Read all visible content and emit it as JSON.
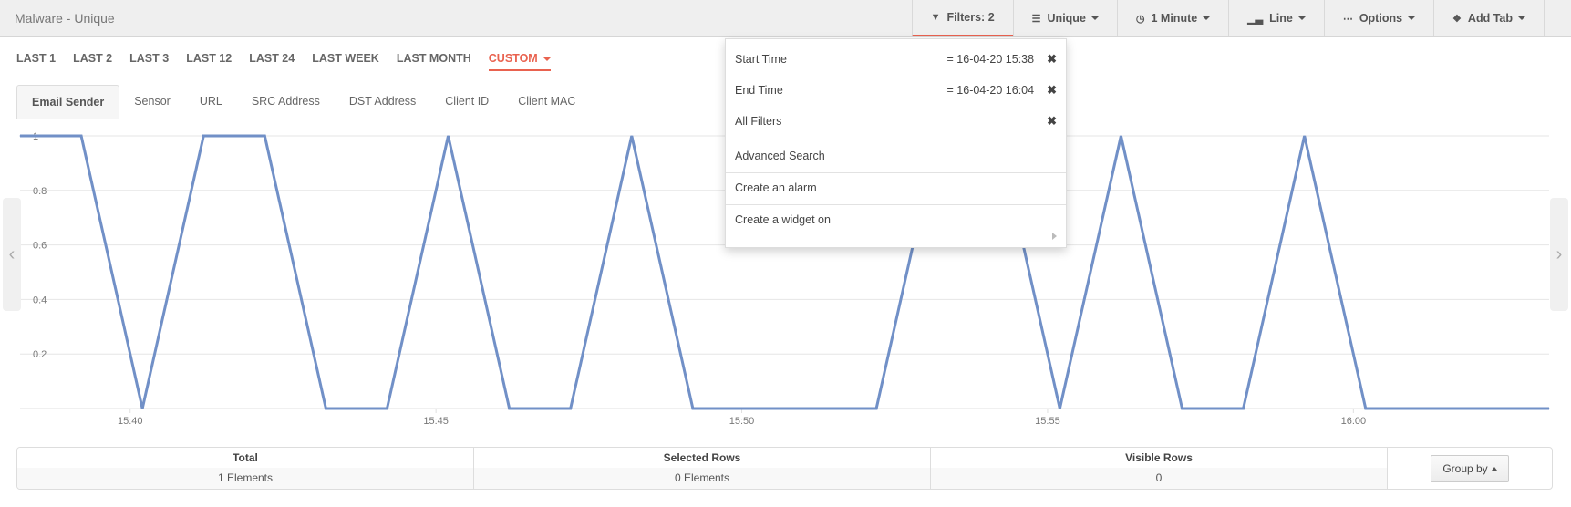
{
  "header": {
    "title": "Malware - Unique",
    "buttons": [
      {
        "icon": "filter-icon",
        "label": "Filters: 2",
        "caret": false
      },
      {
        "icon": "list-icon",
        "label": "Unique",
        "caret": true
      },
      {
        "icon": "clock-icon",
        "label": "1 Minute",
        "caret": true
      },
      {
        "icon": "bar-chart-icon",
        "label": "Line",
        "caret": true
      },
      {
        "icon": "grid-icon",
        "label": "Options",
        "caret": true
      },
      {
        "icon": "tags-icon",
        "label": "Add Tab",
        "caret": true
      }
    ]
  },
  "periods": [
    "LAST 1",
    "LAST 2",
    "LAST 3",
    "LAST 12",
    "LAST 24",
    "LAST WEEK",
    "LAST MONTH",
    "CUSTOM"
  ],
  "active_period": "CUSTOM",
  "tabs": [
    "Email Sender",
    "Sensor",
    "URL",
    "SRC Address",
    "DST Address",
    "Client ID",
    "Client MAC"
  ],
  "active_tab": "Email Sender",
  "filters_dropdown": {
    "start_label": "Start Time",
    "start_value": "= 16-04-20 15:38",
    "end_label": "End Time",
    "end_value": "= 16-04-20 16:04",
    "all_filters_label": "All Filters",
    "advanced_search": "Advanced Search",
    "create_alarm": "Create an alarm",
    "create_widget": "Create a widget on"
  },
  "summary": {
    "total_label": "Total",
    "total_value": "1 Elements",
    "selected_label": "Selected Rows",
    "selected_value": "0 Elements",
    "visible_label": "Visible Rows",
    "visible_value": "0",
    "group_by_label": "Group by"
  },
  "colors": {
    "accent": "#e9624f",
    "series": "#7190c7"
  },
  "chart_data": {
    "type": "line",
    "title": "",
    "xlabel": "",
    "ylabel": "",
    "x_unit": "minutes after 15:38",
    "x": [
      0.2,
      1.2,
      2.2,
      3.2,
      4.2,
      5.2,
      6.2,
      7.2,
      8.2,
      9.2,
      10.2,
      11.2,
      12.2,
      13.2,
      14.2,
      15.2,
      16.2,
      17.2,
      18.2,
      19.2,
      20.2,
      21.2,
      22.2,
      23.2,
      24.2,
      25.2
    ],
    "series": [
      {
        "name": "Email Sender",
        "values": [
          1,
          1,
          0,
          1,
          1,
          0,
          0,
          1,
          0,
          0,
          1,
          0,
          0,
          0,
          0,
          1,
          1,
          0,
          1,
          0,
          0,
          1,
          0,
          0,
          0,
          0
        ]
      }
    ],
    "xticks": [
      {
        "value": 2,
        "label": "15:40"
      },
      {
        "value": 7,
        "label": "15:45"
      },
      {
        "value": 12,
        "label": "15:50"
      },
      {
        "value": 17,
        "label": "15:55"
      },
      {
        "value": 22,
        "label": "16:00"
      }
    ],
    "yticks": [
      {
        "value": 1,
        "label": "1"
      },
      {
        "value": 0.8,
        "label": "0.8"
      },
      {
        "value": 0.6,
        "label": "0.6"
      },
      {
        "value": 0.4,
        "label": "0.4"
      },
      {
        "value": 0.2,
        "label": "0.2"
      }
    ],
    "xlim": [
      0.2,
      25.2
    ],
    "ylim": [
      0,
      1
    ],
    "grid": true,
    "legend": "none"
  }
}
